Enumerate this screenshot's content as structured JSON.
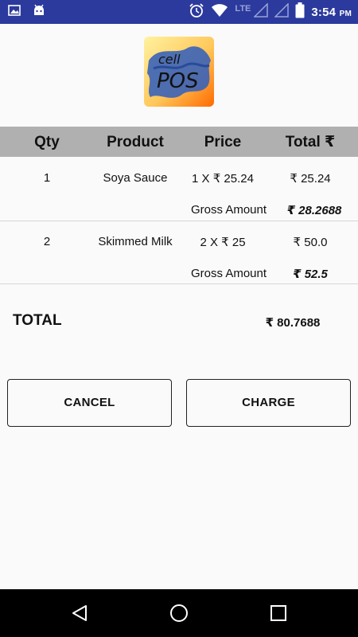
{
  "status_bar": {
    "time": "3:54",
    "am_pm": "PM",
    "network_label": "LTE",
    "icons": [
      "gallery-icon",
      "android-icon",
      "alarm-icon",
      "wifi-icon",
      "signal-icon",
      "battery-icon"
    ]
  },
  "logo": {
    "line1": "cell",
    "line2": "POS"
  },
  "table": {
    "headers": {
      "qty": "Qty",
      "product": "Product",
      "price": "Price",
      "total": "Total ₹"
    },
    "rows": [
      {
        "qty": "1",
        "product": "Soya Sauce",
        "price": "1 X ₹ 25.24",
        "total": "₹ 25.24",
        "gross_label": "Gross Amount",
        "gross_value": "₹ 28.2688"
      },
      {
        "qty": "2",
        "product": "Skimmed Milk",
        "price": "2 X ₹ 25",
        "total": "₹ 50.0",
        "gross_label": "Gross Amount",
        "gross_value": "₹ 52.5"
      }
    ]
  },
  "summary": {
    "total_label": "TOTAL",
    "total_value": "₹ 80.7688"
  },
  "actions": {
    "cancel_label": "CANCEL",
    "charge_label": "CHARGE"
  },
  "colors": {
    "status_bar": "#2b3a9c",
    "header_row": "#b0b0b0",
    "background": "#fafafa",
    "nav_bar": "#000000"
  }
}
